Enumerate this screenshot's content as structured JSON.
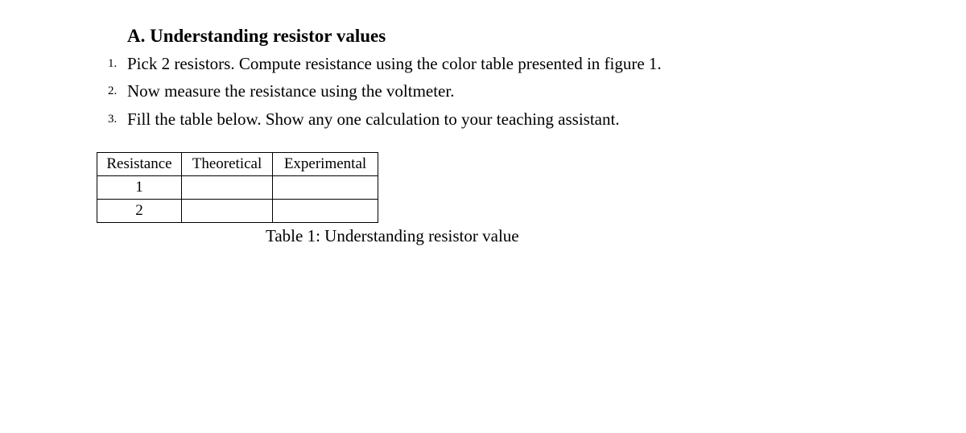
{
  "section": {
    "title": "A. Understanding resistor values",
    "steps": [
      "Pick 2 resistors. Compute resistance using the color table presented in figure 1.",
      "Now measure the resistance using the voltmeter.",
      "Fill the table below. Show any one calculation to your teaching assistant."
    ]
  },
  "table": {
    "headers": [
      "Resistance",
      "Theoretical",
      "Experimental"
    ],
    "rows": [
      {
        "label": "1",
        "theoretical": "",
        "experimental": ""
      },
      {
        "label": "2",
        "theoretical": "",
        "experimental": ""
      }
    ],
    "caption": "Table 1: Understanding resistor value"
  }
}
